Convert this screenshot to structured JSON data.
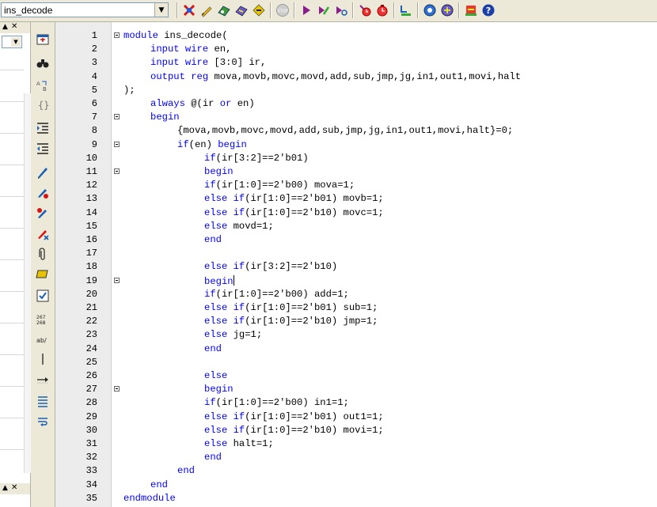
{
  "toolbar": {
    "combo_value": "ins_decode",
    "icons": [
      "compile-icon",
      "pencil-icon",
      "rtl-viewer-icon",
      "analysis-icon",
      "fitter-icon",
      "stop-icon",
      "start-icon",
      "compile-flow-icon",
      "timing-icon",
      "assignment-icon",
      "programmer-icon",
      "signal-tap-icon",
      "netlist-icon",
      "chip-planner-icon",
      "help-icon"
    ]
  },
  "editor": {
    "lines": [
      {
        "n": "1",
        "fold": true,
        "indent": 0,
        "parts": [
          [
            "kw",
            "module"
          ],
          [
            "t",
            " ins_decode("
          ]
        ]
      },
      {
        "n": "2",
        "fold": false,
        "indent": 1,
        "parts": [
          [
            "kw",
            "input wire"
          ],
          [
            "t",
            " en,"
          ]
        ]
      },
      {
        "n": "3",
        "fold": false,
        "indent": 1,
        "parts": [
          [
            "kw",
            "input wire"
          ],
          [
            "t",
            " [3:0] ir,"
          ]
        ]
      },
      {
        "n": "4",
        "fold": false,
        "indent": 1,
        "parts": [
          [
            "kw",
            "output reg"
          ],
          [
            "t",
            " mova,movb,movc,movd,add,sub,jmp,jg,in1,out1,movi,halt"
          ]
        ]
      },
      {
        "n": "5",
        "fold": false,
        "indent": 0,
        "parts": [
          [
            "t",
            ");"
          ]
        ]
      },
      {
        "n": "6",
        "fold": false,
        "indent": 1,
        "parts": [
          [
            "kw",
            "always"
          ],
          [
            "t",
            " @(ir "
          ],
          [
            "kw",
            "or"
          ],
          [
            "t",
            " en)"
          ]
        ]
      },
      {
        "n": "7",
        "fold": true,
        "indent": 1,
        "parts": [
          [
            "kw",
            "begin"
          ]
        ]
      },
      {
        "n": "8",
        "fold": false,
        "indent": 2,
        "parts": [
          [
            "t",
            "{mova,movb,movc,movd,add,sub,jmp,jg,in1,out1,movi,halt}=0;"
          ]
        ]
      },
      {
        "n": "9",
        "fold": true,
        "indent": 2,
        "parts": [
          [
            "kw",
            "if"
          ],
          [
            "t",
            "(en) "
          ],
          [
            "kw",
            "begin"
          ]
        ]
      },
      {
        "n": "10",
        "fold": false,
        "indent": 3,
        "parts": [
          [
            "kw",
            "if"
          ],
          [
            "t",
            "(ir[3:2]==2'b01)"
          ]
        ]
      },
      {
        "n": "11",
        "fold": true,
        "indent": 3,
        "parts": [
          [
            "kw",
            "begin"
          ]
        ]
      },
      {
        "n": "12",
        "fold": false,
        "indent": 3,
        "parts": [
          [
            "kw",
            "if"
          ],
          [
            "t",
            "(ir[1:0]==2'b00) mova=1;"
          ]
        ]
      },
      {
        "n": "13",
        "fold": false,
        "indent": 3,
        "parts": [
          [
            "kw",
            "else if"
          ],
          [
            "t",
            "(ir[1:0]==2'b01) movb=1;"
          ]
        ]
      },
      {
        "n": "14",
        "fold": false,
        "indent": 3,
        "parts": [
          [
            "kw",
            "else if"
          ],
          [
            "t",
            "(ir[1:0]==2'b10) movc=1;"
          ]
        ]
      },
      {
        "n": "15",
        "fold": false,
        "indent": 3,
        "parts": [
          [
            "kw",
            "else"
          ],
          [
            "t",
            " movd=1;"
          ]
        ]
      },
      {
        "n": "16",
        "fold": false,
        "indent": 3,
        "parts": [
          [
            "kw",
            "end"
          ]
        ]
      },
      {
        "n": "17",
        "fold": false,
        "indent": 0,
        "parts": []
      },
      {
        "n": "18",
        "fold": false,
        "indent": 3,
        "parts": [
          [
            "kw",
            "else if"
          ],
          [
            "t",
            "(ir[3:2]==2'b10)"
          ]
        ]
      },
      {
        "n": "19",
        "fold": true,
        "indent": 3,
        "caret": true,
        "parts": [
          [
            "kw",
            "begin"
          ]
        ]
      },
      {
        "n": "20",
        "fold": false,
        "indent": 3,
        "parts": [
          [
            "kw",
            "if"
          ],
          [
            "t",
            "(ir[1:0]==2'b00) add=1;"
          ]
        ]
      },
      {
        "n": "21",
        "fold": false,
        "indent": 3,
        "parts": [
          [
            "kw",
            "else if"
          ],
          [
            "t",
            "(ir[1:0]==2'b01) sub=1;"
          ]
        ]
      },
      {
        "n": "22",
        "fold": false,
        "indent": 3,
        "parts": [
          [
            "kw",
            "else if"
          ],
          [
            "t",
            "(ir[1:0]==2'b10) jmp=1;"
          ]
        ]
      },
      {
        "n": "23",
        "fold": false,
        "indent": 3,
        "parts": [
          [
            "kw",
            "else"
          ],
          [
            "t",
            " jg=1;"
          ]
        ]
      },
      {
        "n": "24",
        "fold": false,
        "indent": 3,
        "parts": [
          [
            "kw",
            "end"
          ]
        ]
      },
      {
        "n": "25",
        "fold": false,
        "indent": 0,
        "parts": []
      },
      {
        "n": "26",
        "fold": false,
        "indent": 3,
        "parts": [
          [
            "kw",
            "else"
          ]
        ]
      },
      {
        "n": "27",
        "fold": true,
        "indent": 3,
        "parts": [
          [
            "kw",
            "begin"
          ]
        ]
      },
      {
        "n": "28",
        "fold": false,
        "indent": 3,
        "parts": [
          [
            "kw",
            "if"
          ],
          [
            "t",
            "(ir[1:0]==2'b00) in1=1;"
          ]
        ]
      },
      {
        "n": "29",
        "fold": false,
        "indent": 3,
        "parts": [
          [
            "kw",
            "else if"
          ],
          [
            "t",
            "(ir[1:0]==2'b01) out1=1;"
          ]
        ]
      },
      {
        "n": "30",
        "fold": false,
        "indent": 3,
        "parts": [
          [
            "kw",
            "else if"
          ],
          [
            "t",
            "(ir[1:0]==2'b10) movi=1;"
          ]
        ]
      },
      {
        "n": "31",
        "fold": false,
        "indent": 3,
        "parts": [
          [
            "kw",
            "else"
          ],
          [
            "t",
            " halt=1;"
          ]
        ]
      },
      {
        "n": "32",
        "fold": false,
        "indent": 3,
        "parts": [
          [
            "kw",
            "end"
          ]
        ]
      },
      {
        "n": "33",
        "fold": false,
        "indent": 2,
        "parts": [
          [
            "kw",
            "end"
          ]
        ]
      },
      {
        "n": "34",
        "fold": false,
        "indent": 1,
        "parts": [
          [
            "kw",
            "end"
          ]
        ]
      },
      {
        "n": "35",
        "fold": false,
        "indent": 0,
        "parts": [
          [
            "kw",
            "endmodule"
          ]
        ]
      }
    ]
  }
}
